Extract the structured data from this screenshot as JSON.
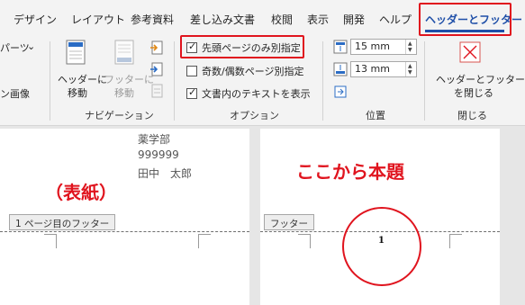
{
  "tabs": [
    "デザイン",
    "レイアウト",
    "参考資料",
    "差し込み文書",
    "校閲",
    "表示",
    "開発",
    "ヘルプ"
  ],
  "active_tab": "ヘッダーとフッター",
  "ribbon": {
    "left_partial": {
      "parts_label": "パーツ",
      "image_label": "ン画像"
    },
    "navigation": {
      "goto_header": [
        "ヘッダーに",
        "移動"
      ],
      "goto_footer": [
        "フッターに",
        "移動"
      ],
      "group_label": "ナビゲーション"
    },
    "options": {
      "first_page": "先頭ページのみ別指定",
      "odd_even": "奇数/偶数ページ別指定",
      "show_text": "文書内のテキストを表示",
      "group_label": "オプション",
      "first_page_checked": true,
      "odd_even_checked": false,
      "show_text_checked": true
    },
    "position": {
      "header_value": "15 mm",
      "footer_value": "13 mm",
      "group_label": "位置"
    },
    "close": {
      "label": [
        "ヘッダーとフッター",
        "を閉じる"
      ],
      "group_label": "閉じる"
    }
  },
  "page1": {
    "lines": [
      "薬学部",
      "999999",
      "田中　太郎"
    ],
    "footer_tag": "1 ページ目のフッター",
    "annotation": "（表紙）"
  },
  "page2": {
    "footer_tag": "フッター",
    "page_number": "1",
    "annotation": "ここから本題"
  },
  "colors": {
    "accent_blue": "#1f4fa8",
    "annotation_red": "#e0141e"
  }
}
